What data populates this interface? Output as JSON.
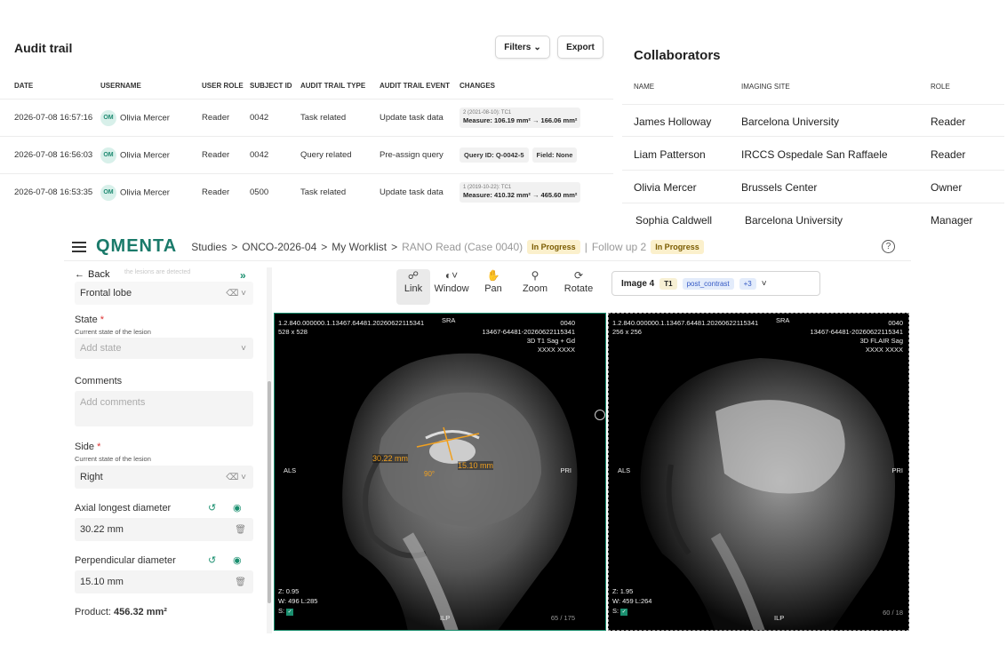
{
  "audit": {
    "title": "Audit trail",
    "filters_label": "Filters",
    "export_label": "Export",
    "columns": [
      "DATE",
      "USERNAME",
      "USER ROLE",
      "SUBJECT ID",
      "AUDIT TRAIL TYPE",
      "AUDIT TRAIL EVENT",
      "CHANGES"
    ],
    "rows": [
      {
        "date": "2026-07-08 16:57:16",
        "initials": "OM",
        "user": "Olivia Mercer",
        "role": "Reader",
        "subject": "0042",
        "type": "Task related",
        "event": "Update task data",
        "change_small": "2 (2021-08-10): TC1",
        "change_main": "Measure: 106.19 mm² → 166.06 mm²"
      },
      {
        "date": "2026-07-08 16:56:03",
        "initials": "OM",
        "user": "Olivia Mercer",
        "role": "Reader",
        "subject": "0042",
        "type": "Query related",
        "event": "Pre-assign query",
        "chip1": "Query ID: Q-0042-5",
        "chip2": "Field: None"
      },
      {
        "date": "2026-07-08 16:53:35",
        "initials": "OM",
        "user": "Olivia Mercer",
        "role": "Reader",
        "subject": "0500",
        "type": "Task related",
        "event": "Update task data",
        "change_small": "1 (2019-10-22): TC1",
        "change_main": "Measure: 410.32 mm² → 465.60 mm²"
      }
    ]
  },
  "collaborators": {
    "title": "Collaborators",
    "columns": [
      "NAME",
      "IMAGING SITE",
      "ROLE"
    ],
    "rows": [
      {
        "name": "James Holloway",
        "site": "Barcelona University",
        "role": "Reader"
      },
      {
        "name": "Liam Patterson",
        "site": "IRCCS Ospedale San Raffaele",
        "role": "Reader"
      },
      {
        "name": "Olivia Mercer",
        "site": "Brussels Center",
        "role": "Owner"
      },
      {
        "name": "Sophia Caldwell",
        "site": "Barcelona University",
        "role": "Manager"
      }
    ]
  },
  "viewer": {
    "logo": "QMENTA",
    "breadcrumb": [
      "Studies",
      "ONCO-2026-04",
      "My Worklist",
      "RANO Read (Case 0040)"
    ],
    "status1": "In Progress",
    "followup": "Follow up 2",
    "status2": "In Progress",
    "help": "?",
    "panel": {
      "back": "Back",
      "faint": "the lesions are detected",
      "location_value": "Frontal lobe",
      "state_label": "State",
      "state_sub": "Current state of the lesion",
      "state_placeholder": "Add state",
      "comments_label": "Comments",
      "comments_placeholder": "Add comments",
      "side_label": "Side",
      "side_sub": "Current state of the lesion",
      "side_value": "Right",
      "axial_label": "Axial longest diameter",
      "axial_value": "30.22 mm",
      "perp_label": "Perpendicular diameter",
      "perp_value": "15.10 mm",
      "product_label": "Product:",
      "product_value": "456.32 mm²"
    },
    "tools": [
      {
        "icon": "link-icon",
        "label": "Link"
      },
      {
        "icon": "window-icon",
        "label": "Window"
      },
      {
        "icon": "pan-icon",
        "label": "Pan"
      },
      {
        "icon": "zoom-icon",
        "label": "Zoom"
      },
      {
        "icon": "rotate-icon",
        "label": "Rotate"
      }
    ],
    "image_selector": {
      "label": "Image 4",
      "tag1": "T1",
      "tag2": "post_contrast",
      "more": "+3"
    },
    "vp1": {
      "uid": "1.2.840.000000.1.13467.64481.20260622115341",
      "sra": "SRA",
      "size": "528 x 528",
      "id": "0040",
      "series": "13467-64481-20260622115341",
      "seq": "3D T1 Sag + Gd",
      "anon": "XXXX XXXX",
      "left": "ALS",
      "right": "PRI",
      "bottom": "ILP",
      "zoom": "Z: 0.95",
      "wl": "W: 496 L:285",
      "s": "S:",
      "frame": "65 / 175",
      "m1": "30.22 mm",
      "m2": "15.10 mm",
      "angle": "90°"
    },
    "vp2": {
      "uid": "1.2.840.000000.1.13467.64481.20260622115341",
      "sra": "SRA",
      "size": "256 x 256",
      "id": "0040",
      "series": "13467-64481-20260622115341",
      "seq": "3D FLAIR Sag",
      "anon": "XXXX XXXX",
      "left": "ALS",
      "right": "PRI",
      "bottom": "ILP",
      "zoom": "Z: 1.95",
      "wl": "W: 459 L:264",
      "s": "S:",
      "frame": "60 / 18"
    }
  }
}
